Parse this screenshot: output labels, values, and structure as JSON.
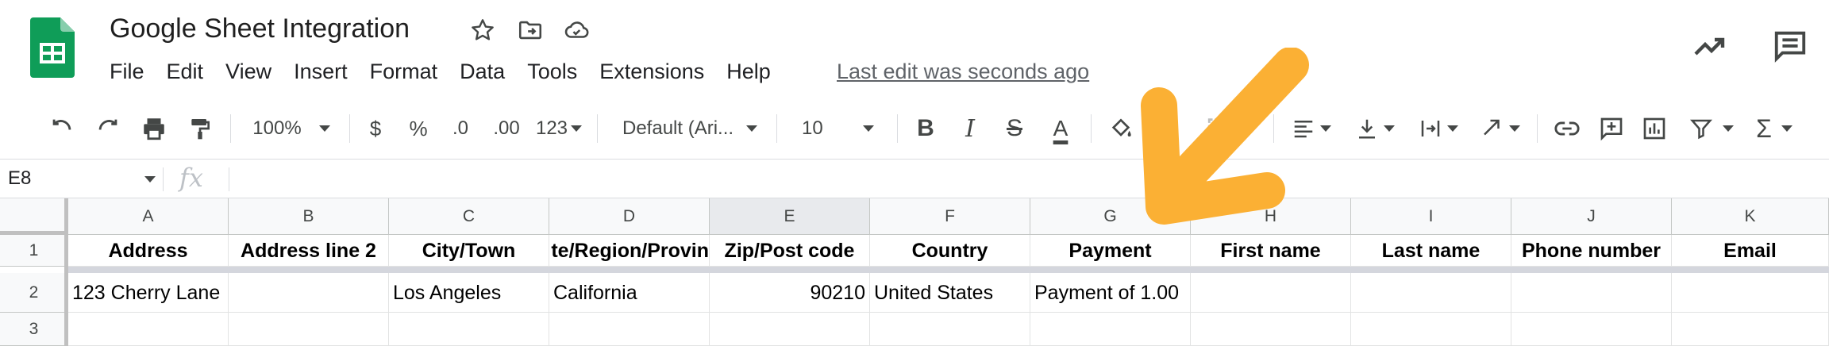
{
  "app": {
    "title": "Google Sheet Integration",
    "last_edit": "Last edit was seconds ago",
    "brand_color": "#0f9d58",
    "annotation_arrow_color": "#fbb034"
  },
  "menu": [
    "File",
    "Edit",
    "View",
    "Insert",
    "Format",
    "Data",
    "Tools",
    "Extensions",
    "Help"
  ],
  "toolbar": {
    "zoom": "100%",
    "currency": "$",
    "percent": "%",
    "decrease_decimal": ".0",
    "increase_decimal": ".00",
    "number_format": "123",
    "font": "Default (Ari...",
    "font_size": "10"
  },
  "formula_bar": {
    "name_box": "E8",
    "fx": "fx"
  },
  "grid": {
    "columns": [
      "A",
      "B",
      "C",
      "D",
      "E",
      "F",
      "G",
      "H",
      "I",
      "J",
      "K"
    ],
    "selected_column": "E",
    "row_numbers": [
      "1",
      "2",
      "3"
    ],
    "header_row": [
      "Address",
      "Address line 2",
      "City/Town",
      "te/Region/Provin",
      "Zip/Post code",
      "Country",
      "Payment",
      "First name",
      "Last name",
      "Phone number",
      "Email"
    ],
    "data_rows": [
      [
        "123 Cherry Lane",
        "",
        "Los Angeles",
        "California",
        "90210",
        "United States",
        "Payment of 1.00",
        "",
        "",
        "",
        ""
      ],
      [
        "",
        "",
        "",
        "",
        "",
        "",
        "",
        "",
        "",
        "",
        ""
      ]
    ]
  }
}
